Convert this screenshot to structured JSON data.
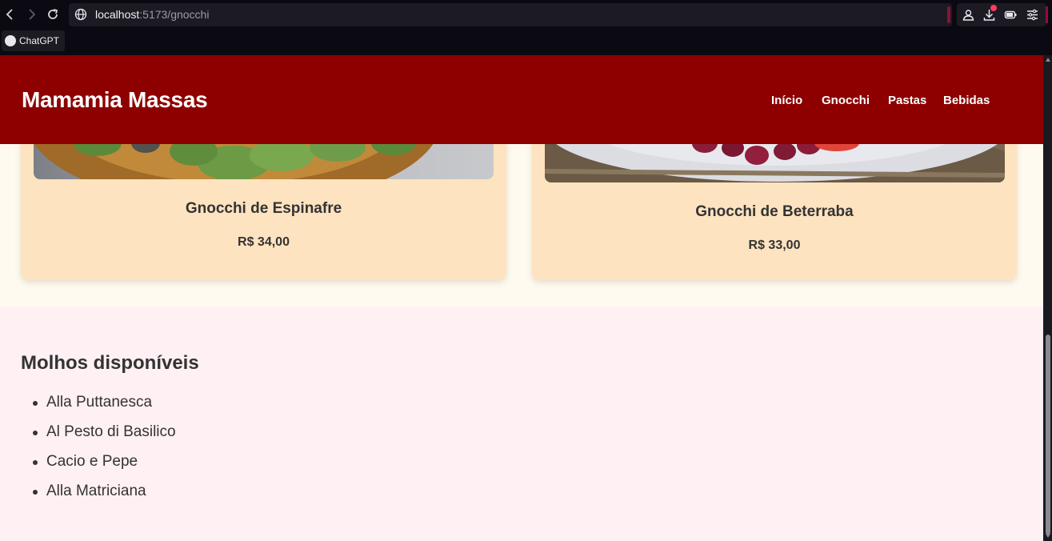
{
  "browser": {
    "url_host": "localhost",
    "url_path": ":5173/gnocchi",
    "bookmark_label": "ChatGPT"
  },
  "header": {
    "brand": "Mamamia Massas",
    "nav": [
      "Início",
      "Gnocchi",
      "Pastas",
      "Bebidas"
    ]
  },
  "products": [
    {
      "name": "Gnocchi de Espinafre",
      "price": "R$ 34,00"
    },
    {
      "name": "Gnocchi de Beterraba",
      "price": "R$ 33,00"
    }
  ],
  "sauces": {
    "title": "Molhos disponíveis",
    "items": [
      "Alla Puttanesca",
      "Al Pesto di Basilico",
      "Cacio e Pepe",
      "Alla Matriciana"
    ]
  },
  "colors": {
    "header_bg": "#8e0000",
    "card_bg": "#fde3c0",
    "sauces_bg": "#fff0f3",
    "page_bg": "#fefaf0"
  }
}
